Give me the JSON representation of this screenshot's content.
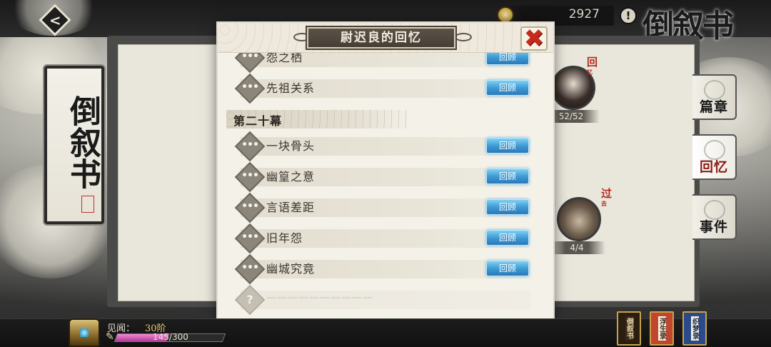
{
  "header": {
    "coin_value": "2927",
    "info_icon": "!",
    "title": "倒叙书"
  },
  "left_scroll": {
    "title": "倒叙书",
    "seal": "印章"
  },
  "right_tabs": [
    {
      "label": "篇章",
      "active": false
    },
    {
      "label": "回忆",
      "active": true
    },
    {
      "label": "事件",
      "active": false
    }
  ],
  "characters": [
    {
      "tag": "回",
      "tag_small": "忆",
      "count": "52/52"
    },
    {
      "tag": "过",
      "tag_small": "去",
      "count": "4/4"
    }
  ],
  "modal": {
    "title": "尉迟良的回忆",
    "close_icon": "close-icon",
    "review_label": "回顾",
    "items_before": [
      {
        "label": "怨之栖"
      },
      {
        "label": "先祖关系"
      }
    ],
    "chapter_title": "第二十幕",
    "items_after": [
      {
        "label": "一块骨头"
      },
      {
        "label": "幽篁之意"
      },
      {
        "label": "言语差距"
      },
      {
        "label": "旧年怨"
      },
      {
        "label": "幽城究竟"
      }
    ],
    "locked_item": {
      "icon": "?",
      "label": "——————————"
    }
  },
  "footer": {
    "exp_label": "见闻：",
    "exp_level": "30阶",
    "exp_progress": "145/300",
    "exp_fraction": 0.483,
    "books": [
      {
        "label": "倒叙书"
      },
      {
        "label": "浮生录"
      },
      {
        "label": "织梦录"
      }
    ]
  },
  "colors": {
    "review_button": "#3f9bd4",
    "close_x": "#c62a1a",
    "active_tab": "#8a1c16",
    "exp_fill": "#d45ab6"
  }
}
